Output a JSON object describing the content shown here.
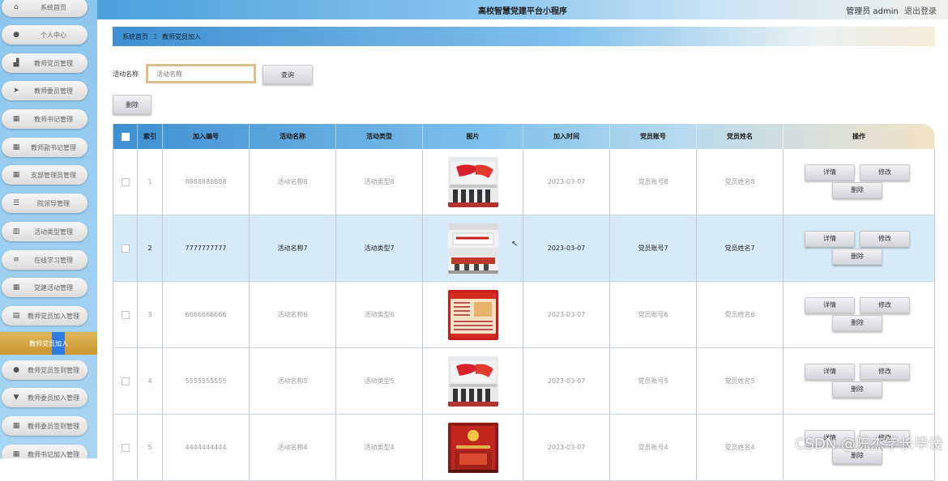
{
  "header": {
    "title": "高校智慧党建平台小程序",
    "user_label": "管理员 admin",
    "logout_label": "退出登录"
  },
  "sidebar": {
    "items": [
      {
        "label": "系统首页",
        "icon": "home-icon",
        "glyph": "⌂"
      },
      {
        "label": "个人中心",
        "icon": "user-icon",
        "glyph": "●"
      },
      {
        "label": "教师党员管理",
        "icon": "bar-chart-icon",
        "glyph": "▟"
      },
      {
        "label": "教师委员管理",
        "icon": "send-icon",
        "glyph": "➤"
      },
      {
        "label": "教师书记管理",
        "icon": "grid-icon",
        "glyph": "▦"
      },
      {
        "label": "教师副书记管理",
        "icon": "grid-icon",
        "glyph": "▦"
      },
      {
        "label": "支部管理员管理",
        "icon": "grid-icon",
        "glyph": "▦"
      },
      {
        "label": "院领导管理",
        "icon": "sliders-icon",
        "glyph": "☰"
      },
      {
        "label": "活动类型管理",
        "icon": "chart-icon",
        "glyph": "▥"
      },
      {
        "label": "在线学习管理",
        "icon": "list-icon",
        "glyph": "≡"
      },
      {
        "label": "党建活动管理",
        "icon": "grid-icon",
        "glyph": "▦"
      },
      {
        "label": "教师党员加入管理",
        "icon": "clipboard-icon",
        "glyph": "▤"
      }
    ],
    "active_label": "教师党员加入",
    "items_after": [
      {
        "label": "教师党员签到管理",
        "icon": "user-icon",
        "glyph": "●"
      },
      {
        "label": "教师委员加入管理",
        "icon": "download-icon",
        "glyph": "▼"
      },
      {
        "label": "教师委员签到管理",
        "icon": "grid-icon",
        "glyph": "▦"
      },
      {
        "label": "教师书记加入管理",
        "icon": "grid-icon",
        "glyph": "▦"
      }
    ]
  },
  "breadcrumb": {
    "home": "系统首页",
    "separator": "Ξ",
    "current": "教师党员加入"
  },
  "search": {
    "label": "活动名称",
    "placeholder": "活动名称",
    "query_label": "查询"
  },
  "toolbar": {
    "delete_label": "删除"
  },
  "table": {
    "columns": [
      "索引",
      "加入编号",
      "活动名称",
      "活动类型",
      "图片",
      "加入时间",
      "党员账号",
      "党员姓名",
      "操作"
    ],
    "actions": {
      "detail": "详情",
      "edit": "修改",
      "delete": "删除"
    },
    "rows": [
      {
        "index": "1",
        "join_no": "8888888888",
        "activity_name": "活动名称8",
        "activity_type": "活动类型8",
        "image": "flag-hall",
        "join_time": "2023-03-07",
        "member_account": "党员账号8",
        "member_name": "党员姓名8",
        "highlighted": false
      },
      {
        "index": "2",
        "join_no": "7777777777",
        "activity_name": "活动名称7",
        "activity_type": "活动类型7",
        "image": "meeting-room",
        "join_time": "2023-03-07",
        "member_account": "党员账号7",
        "member_name": "党员姓名7",
        "highlighted": true
      },
      {
        "index": "3",
        "join_no": "6666666666",
        "activity_name": "活动名称6",
        "activity_type": "活动类型6",
        "image": "poster-board",
        "join_time": "2023-03-07",
        "member_account": "党员账号6",
        "member_name": "党员姓名6",
        "highlighted": false
      },
      {
        "index": "4",
        "join_no": "5555555555",
        "activity_name": "活动名称5",
        "activity_type": "活动类型5",
        "image": "flag-hall",
        "join_time": "2023-03-07",
        "member_account": "党员账号5",
        "member_name": "党员姓名5",
        "highlighted": false
      },
      {
        "index": "5",
        "join_no": "4444444444",
        "activity_name": "活动名称4",
        "activity_type": "活动类型4",
        "image": "party-hall",
        "join_time": "2023-03-07",
        "member_account": "党员账号4",
        "member_name": "党员姓名4",
        "highlighted": false
      }
    ]
  },
  "watermark": "CSDN @陈杰学长毕设"
}
